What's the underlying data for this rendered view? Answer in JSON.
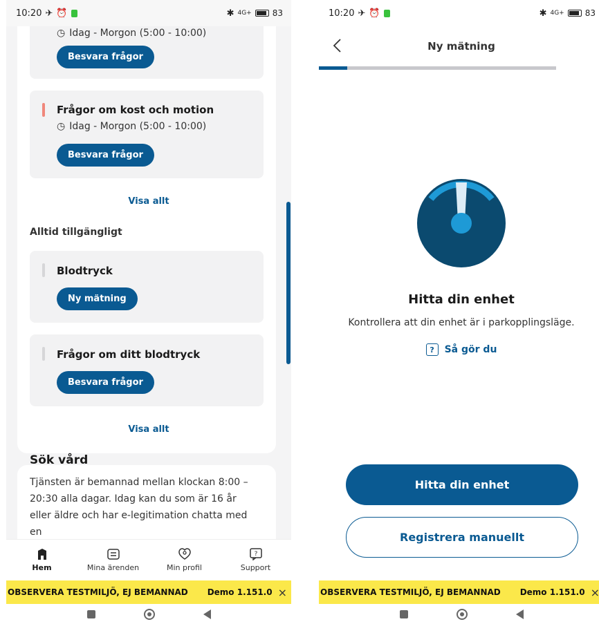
{
  "status_bar": {
    "time": "10:20",
    "signal": "4G+",
    "battery": "83"
  },
  "left": {
    "tasks_top": [
      {
        "title": "",
        "time": "Idag - Morgon (5:00 - 10:00)",
        "button": "Besvara frågor"
      },
      {
        "title": "Frågor om kost och motion",
        "time": "Idag - Morgon (5:00 - 10:00)",
        "button": "Besvara frågor"
      }
    ],
    "show_all_1": "Visa allt",
    "always_heading": "Alltid tillgängligt",
    "always_items": [
      {
        "title": "Blodtryck",
        "button": "Ny mätning"
      },
      {
        "title": "Frågor om ditt blodtryck",
        "button": "Besvara frågor"
      }
    ],
    "show_all_2": "Visa allt",
    "sok": {
      "title": "Sök vård",
      "text": "Tjänsten är bemannad mellan klockan 8:00 – 20:30 alla dagar. Idag kan du som är 16 år eller äldre och har e-legitimation chatta med en"
    },
    "nav": [
      {
        "label": "Hem",
        "icon": "home-icon"
      },
      {
        "label": "Mina ärenden",
        "icon": "cases-icon"
      },
      {
        "label": "Min profil",
        "icon": "profile-icon"
      },
      {
        "label": "Support",
        "icon": "support-icon"
      }
    ],
    "banner": {
      "text": "OBSERVERA TESTMILJÖ, EJ BEMANNAD",
      "version": "Demo 1.151.0",
      "close": "×"
    }
  },
  "right": {
    "title": "Ny mätning",
    "progress": 0.12,
    "heading": "Hitta din enhet",
    "subtitle": "Kontrollera att din enhet är i parkopplingsläge.",
    "howto": "Så gör du",
    "primary_button": "Hitta din enhet",
    "secondary_button": "Registrera manuellt",
    "banner": {
      "text": "OBSERVERA TESTMILJÖ, EJ BEMANNAD",
      "version": "Demo 1.151.0",
      "close": "×"
    }
  },
  "colors": {
    "accent": "#0a5a92",
    "accent_light": "#1e9ad6",
    "gauge_dark": "#0b4a6f",
    "banner": "#fbe84a",
    "urgent": "#f0877b"
  }
}
